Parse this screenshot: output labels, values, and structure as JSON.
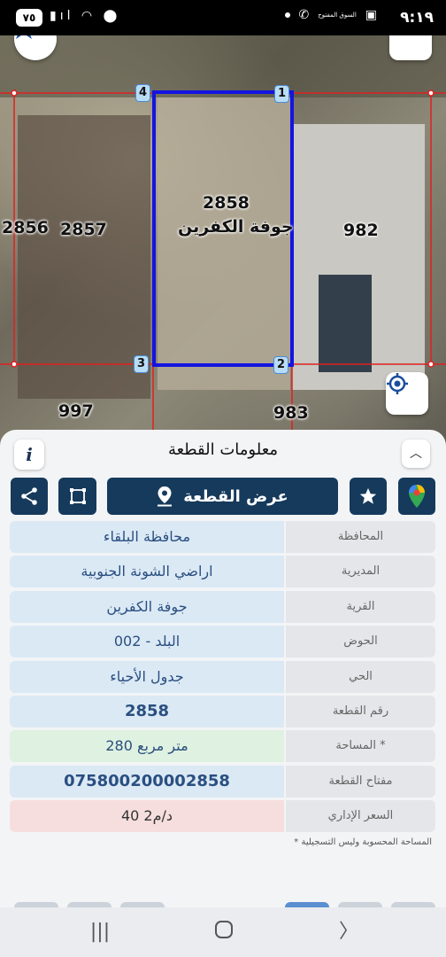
{
  "status": {
    "time": "٩:١٩",
    "battery": "٧٥",
    "mini_app": "السوق المفتوح"
  },
  "map": {
    "parcel_numbers": {
      "center": "2858",
      "left": "2857",
      "far_left": "2856",
      "right": "982",
      "bottom_left": "997",
      "bottom_right": "983"
    },
    "village_label": "جوفة الكفرين",
    "corners": [
      "1",
      "2",
      "3",
      "4"
    ]
  },
  "panel": {
    "title": "معلومات القطعة",
    "info_label": "i",
    "show_parcel_button": "عرض القطعة",
    "rows": [
      {
        "label": "المحافظة",
        "value": "محافظة البلقاء"
      },
      {
        "label": "المديرية",
        "value": "اراضي الشونة الجنوبية"
      },
      {
        "label": "القرية",
        "value": "جوفة الكفرين"
      },
      {
        "label": "الحوض",
        "value": "البلد - 002"
      },
      {
        "label": "الحي",
        "value": "جدول الأحياء"
      },
      {
        "label": "رقم القطعة",
        "value": "2858"
      },
      {
        "label": "المساحة *",
        "value": "280  متر مربع"
      },
      {
        "label": "مفتاح القطعة",
        "value": "075800200002858"
      },
      {
        "label": "السعر الإداري",
        "value": "40 د/م2"
      }
    ],
    "footnote": "* المساحة المحسوبة وليس التسجيلية"
  },
  "colors": {
    "primary": "#163a5c",
    "parcel_outline": "#1414e0",
    "neighbor_outline": "#e02020"
  }
}
